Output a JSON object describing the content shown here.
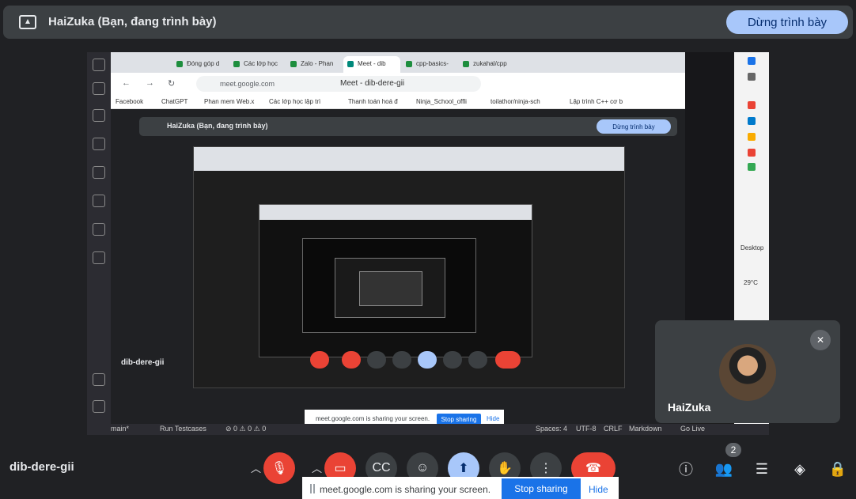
{
  "banner": {
    "title": "HaiZuka (Bạn, đang trình bày)",
    "stop_label": "Dừng trình bày"
  },
  "browser": {
    "tabs": [
      "Đóng góp d",
      "Các lớp học",
      "Zalo - Phan",
      "Meet - dib",
      "cpp-basics-",
      "zukahal/cpp"
    ],
    "address": "meet.google.com",
    "page_title": "Meet - dib-dere-gii",
    "bookmarks": [
      "Facebook",
      "ChatGPT",
      "Phan mem Web.x",
      "Các lớp học lập trì",
      "Thanh toán hoá đ",
      "Ninja_School_offli",
      "toilathor/ninja-sch",
      "Lập trình C++ cơ b"
    ]
  },
  "inner_banner": {
    "title": "HaiZuka (Bạn, đang trình bày)",
    "stop_label": "Dừng trình bày"
  },
  "inner_meeting_code": "dib-dere-gii",
  "inner_share": {
    "message": "meet.google.com is sharing your screen.",
    "stop": "Stop sharing",
    "hide": "Hide"
  },
  "taskbar": {
    "desktop": "Desktop",
    "temp": "29°C"
  },
  "status_bar": {
    "branch": "main*",
    "run": "Run Testcases",
    "counts": "⊘ 0 ⚠ 0  ⚠ 0",
    "spaces": "Spaces: 4",
    "encoding": "UTF-8",
    "eol": "CRLF",
    "lang": "Markdown",
    "live": "Go Live"
  },
  "participant": {
    "name": "HaiZuka",
    "inner_name": "HaiZuka",
    "count": "2"
  },
  "meeting": {
    "code": "dib-dere-gii",
    "participant_badge": "2"
  },
  "share_bar": {
    "message": "meet.google.com is sharing your screen.",
    "stop": "Stop sharing",
    "hide": "Hide"
  },
  "colors": {
    "background": "#202124",
    "surface": "#3c4043",
    "accent": "#a8c7fa",
    "danger": "#ea4335",
    "primary": "#1a73e8"
  },
  "icons": [
    "present-icon",
    "mic-off-icon",
    "camera-off-icon",
    "captions-icon",
    "emoji-icon",
    "present-screen-icon",
    "raise-hand-icon",
    "more-options-icon",
    "hang-up-icon",
    "info-icon",
    "people-icon",
    "chat-icon",
    "activities-icon",
    "host-controls-icon"
  ]
}
